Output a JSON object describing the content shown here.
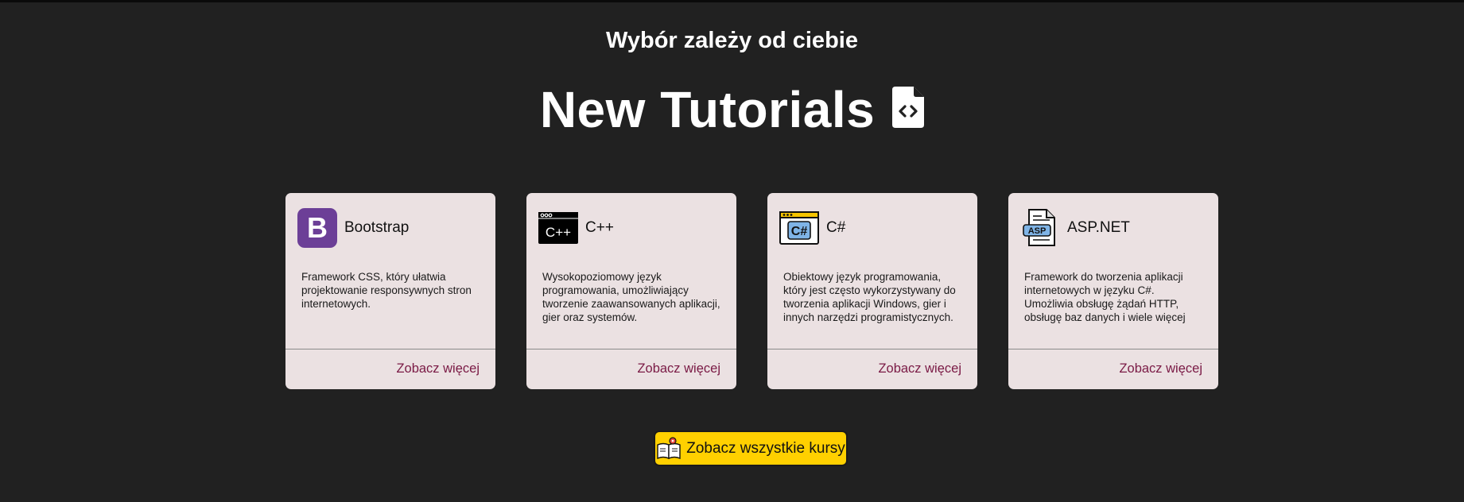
{
  "header": {
    "subtitle": "Wybór zależy od ciebie",
    "title": "New Tutorials",
    "title_icon": "file-code-icon"
  },
  "cards": [
    {
      "title": "Bootstrap",
      "icon": "bootstrap-logo-icon",
      "accent": "#6c3f97",
      "description": "Framework CSS, który ułatwia projektowanie responsywnych stron internetowych.",
      "link": "Zobacz więcej"
    },
    {
      "title": "C++",
      "icon": "cpp-window-icon",
      "accent": "#000000",
      "description": "Wysokopoziomowy język programowania, umożliwiający tworzenie zaawansowanych aplikacji, gier oraz systemów.",
      "link": "Zobacz więcej"
    },
    {
      "title": "C#",
      "icon": "csharp-window-icon",
      "accent": "#7fb4e6",
      "description": "Obiektowy język programowania, który jest często wykorzystywany do tworzenia aplikacji Windows, gier i innych narzędzi programistycznych.",
      "link": "Zobacz więcej"
    },
    {
      "title": "ASP.NET",
      "icon": "asp-file-icon",
      "accent": "#7fb4e6",
      "description": "Framework do tworzenia aplikacji internetowych w języku C#. Umożliwia obsługę żądań HTTP, obsługę baz danych i wiele więcej",
      "link": "Zobacz więcej"
    }
  ],
  "cta": {
    "label": "Zobacz wszystkie kursy",
    "icon": "open-book-icon",
    "color": "#ffd000"
  },
  "colors": {
    "background": "#212121",
    "card": "#ebe1e2",
    "link": "#7a1a45"
  }
}
